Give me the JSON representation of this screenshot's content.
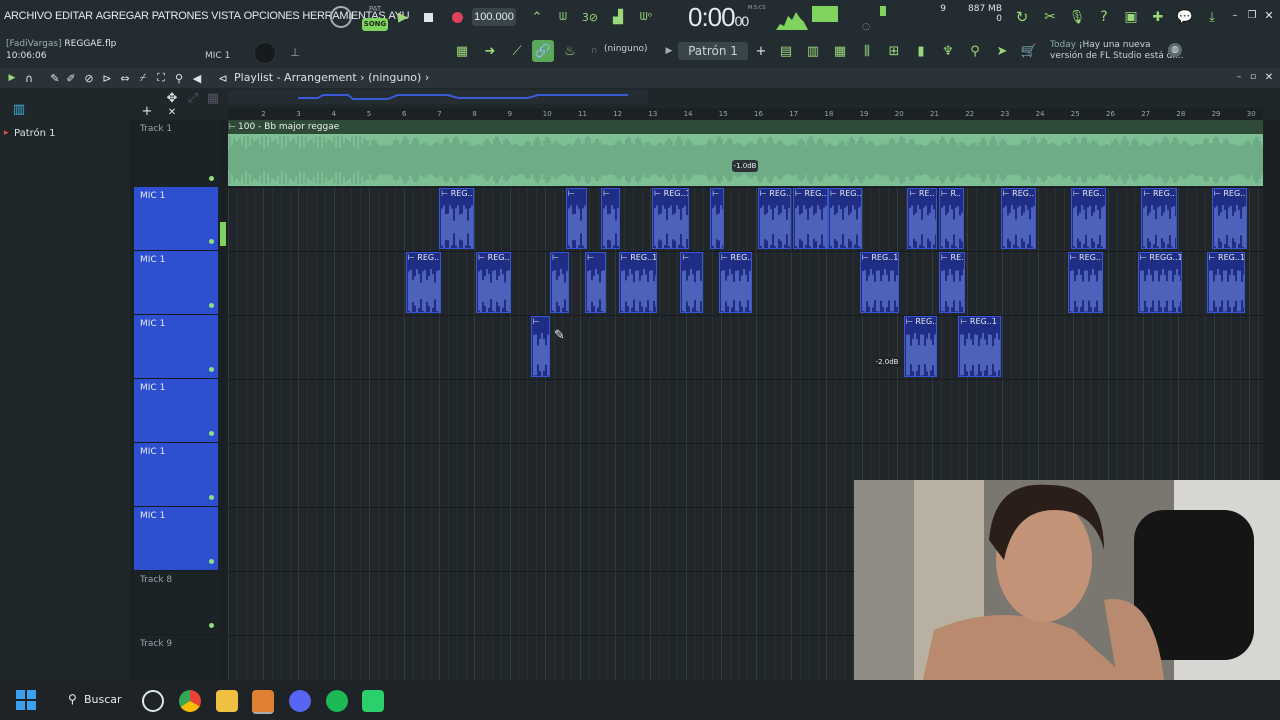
{
  "menu": [
    "ARCHIVO",
    "EDITAR",
    "AGREGAR",
    "PATRONES",
    "VISTA",
    "OPCIONES",
    "HERRAMIENTAS",
    "AYU"
  ],
  "mode": {
    "pat": "PAT",
    "song": "SONG"
  },
  "tempo": "100.000",
  "time": {
    "main": "0:00",
    "sub": "00",
    "label": "M:S:CS"
  },
  "resources": {
    "top": "9",
    "mem": "887 MB",
    "mem_sub": "0"
  },
  "file": {
    "user": "[FadiVargas]",
    "name": "REGGAE.flp"
  },
  "clock": "10:06:06",
  "mic_label": "MIC 1",
  "pattern_selector": {
    "ninguno": "(ninguno)",
    "pattern": "Patrón 1"
  },
  "news": {
    "today": "Today",
    "line1": "¡Hay una nueva",
    "line2": "versión de FL Studio está di..."
  },
  "playlist": {
    "title": "Playlist - Arrangement",
    "sub": "(ninguno)"
  },
  "picker": {
    "item": "Patrón 1"
  },
  "ruler": [
    "2",
    "3",
    "4",
    "5",
    "6",
    "7",
    "8",
    "9",
    "10",
    "11",
    "12",
    "13",
    "14",
    "15",
    "16",
    "17",
    "18",
    "19",
    "20",
    "21",
    "22",
    "23",
    "24",
    "25",
    "26",
    "27",
    "28",
    "29",
    "30"
  ],
  "tracks": [
    {
      "label": "Track 1",
      "style": "dark"
    },
    {
      "label": "MIC 1",
      "style": "blue"
    },
    {
      "label": "MIC 1",
      "style": "blue"
    },
    {
      "label": "MIC 1",
      "style": "blue"
    },
    {
      "label": "MIC 1",
      "style": "blue"
    },
    {
      "label": "MIC 1",
      "style": "blue"
    },
    {
      "label": "MIC 1",
      "style": "blue"
    },
    {
      "label": "Track 8",
      "style": "dark"
    },
    {
      "label": "Track 9",
      "style": "dark"
    }
  ],
  "audio_clip": {
    "label": "100 - Bb major reggae",
    "gain": "-1.0dB"
  },
  "clip_gain2": "-2.0dB",
  "taskbar": {
    "search": "Buscar"
  },
  "colors": {
    "accent": "#7fd35e",
    "track_blue": "#2e4fd0",
    "clip_blue": "#1f2d85",
    "audio_green": "#7fbf96"
  }
}
